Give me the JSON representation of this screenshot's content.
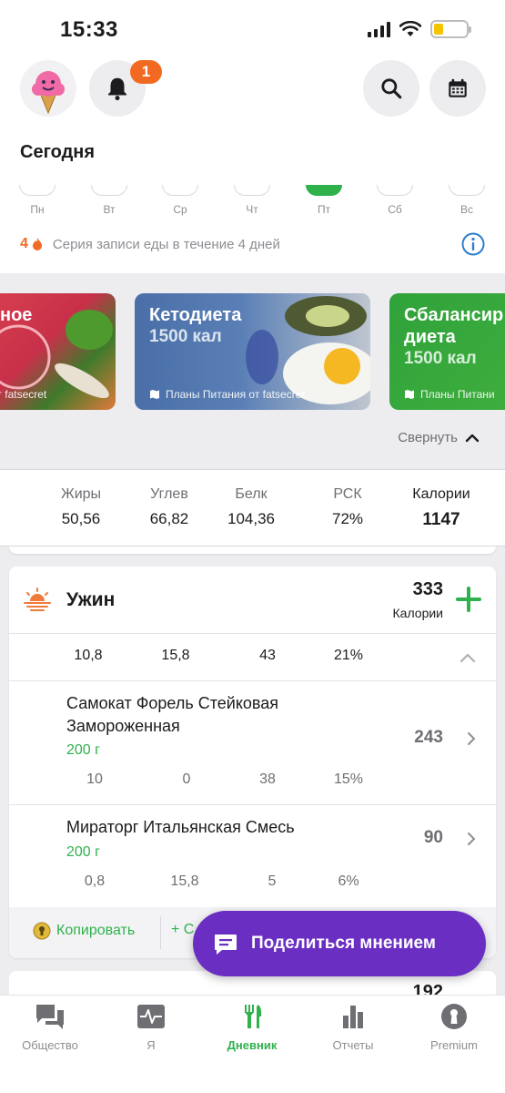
{
  "status_bar": {
    "time": "15:33"
  },
  "header": {
    "notification_count": "1",
    "title": "Сегодня"
  },
  "week": {
    "days": [
      "Пн",
      "Вт",
      "Ср",
      "Чт",
      "Пт",
      "Сб",
      "Вс"
    ],
    "active_index": 4
  },
  "streak": {
    "count": "4",
    "text": "Серия записи еды в течение 4 дней"
  },
  "plans": [
    {
      "title": "ное",
      "kcal": "",
      "source": "от fatsecret"
    },
    {
      "title": "Кетодиета",
      "kcal": "1500 кал",
      "source": "Планы Питания от fatsecret"
    },
    {
      "title": "Сбалансир\nдиета",
      "kcal": "1500 кал",
      "source": "Планы Питани"
    }
  ],
  "collapse_label": "Свернуть",
  "summary": {
    "fat_label": "Жиры",
    "fat": "50,56",
    "carbs_label": "Углев",
    "carbs": "66,82",
    "protein_label": "Белк",
    "protein": "104,36",
    "rdi_label": "РСК",
    "rdi": "72%",
    "cal_label": "Калории",
    "cal": "1147"
  },
  "meal": {
    "name": "Ужин",
    "calories": "333",
    "calories_label": "Калории",
    "macros": {
      "fat": "10,8",
      "carbs": "15,8",
      "protein": "43",
      "rdi": "21%"
    },
    "foods": [
      {
        "name": "Самокат Форель Стейковая Замороженная",
        "portion": "200 г",
        "calories": "243",
        "fat": "10",
        "carbs": "0",
        "protein": "38",
        "rdi": "15%"
      },
      {
        "name": "Мираторг Итальянская Смесь",
        "portion": "200 г",
        "calories": "90",
        "fat": "0,8",
        "carbs": "15,8",
        "protein": "5",
        "rdi": "6%"
      }
    ],
    "copy_label": "Копировать",
    "add_label": "+ С"
  },
  "next_meal": {
    "calories": "192"
  },
  "fab": {
    "label": "Поделиться мнением"
  },
  "tabs": [
    {
      "label": "Общество",
      "icon": "chat-icon"
    },
    {
      "label": "Я",
      "icon": "health-icon"
    },
    {
      "label": "Дневник",
      "icon": "fork-knife-icon"
    },
    {
      "label": "Отчеты",
      "icon": "bar-chart-icon"
    },
    {
      "label": "Premium",
      "icon": "keyhole-icon"
    }
  ],
  "colors": {
    "accent_green": "#2fb24c",
    "streak_orange": "#f26a21",
    "fab_purple": "#6a2fc2",
    "info_blue": "#2a7dd1"
  }
}
